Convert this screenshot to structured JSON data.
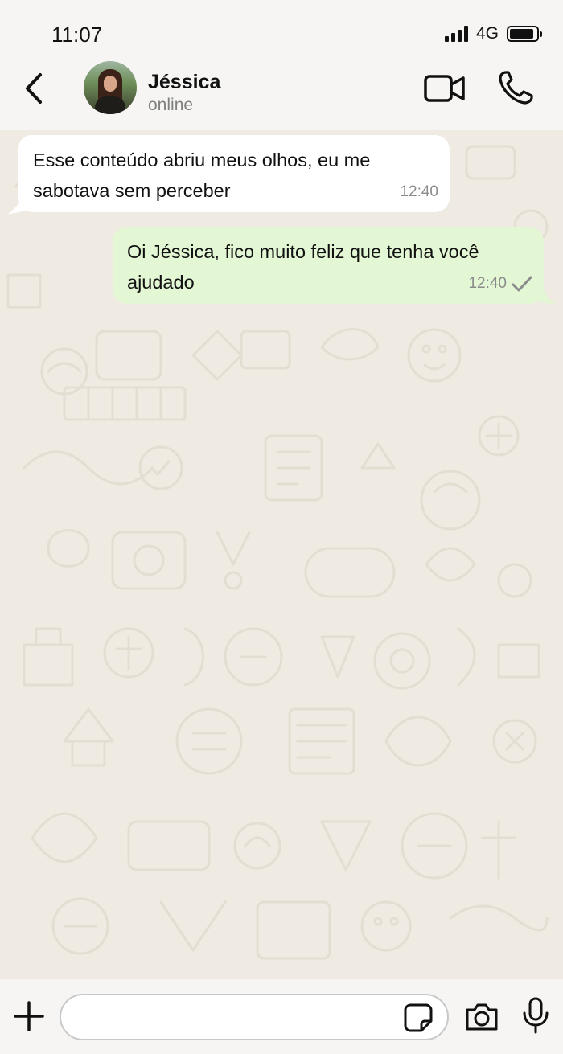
{
  "status_bar": {
    "time": "11:07",
    "network": "4G",
    "signal_icon": "signal-bars-icon",
    "battery_icon": "battery-icon",
    "battery_level": 0.9
  },
  "header": {
    "back_icon": "chevron-left-icon",
    "contact_name": "Jéssica",
    "contact_status": "online",
    "video_icon": "video-camera-icon",
    "call_icon": "phone-icon"
  },
  "messages": [
    {
      "direction": "incoming",
      "text": "Esse conteúdo abriu meus olhos, eu me sabotava sem perceber",
      "time": "12:40"
    },
    {
      "direction": "outgoing",
      "text": "Oi Jéssica, fico muito feliz que tenha você ajudado",
      "time": "12:40",
      "status_icon": "single-check-icon"
    }
  ],
  "input_bar": {
    "plus_icon": "plus-icon",
    "message_value": "",
    "sticker_icon": "sticker-icon",
    "camera_icon": "camera-icon",
    "mic_icon": "microphone-icon"
  },
  "colors": {
    "background": "#f6f5f3",
    "chat_background": "#efeae2",
    "incoming_bubble": "#ffffff",
    "outgoing_bubble": "#e3f7d5",
    "meta_text": "#8b8b8b"
  }
}
